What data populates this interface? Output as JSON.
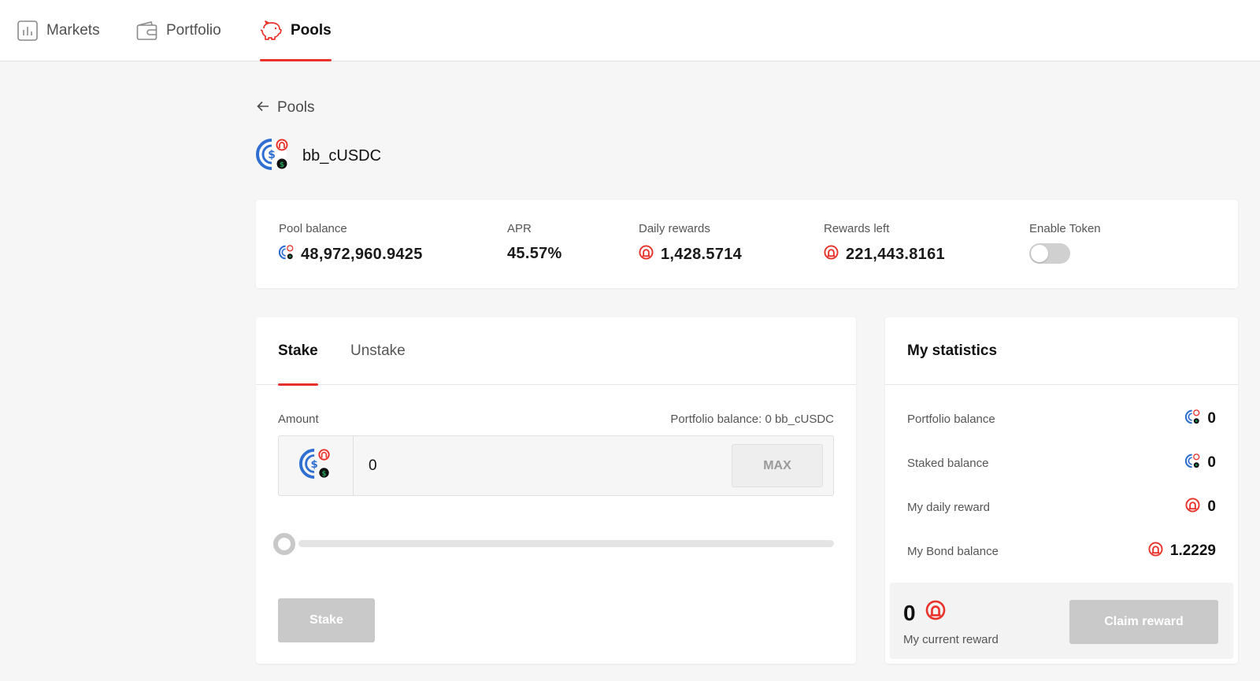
{
  "nav": {
    "items": [
      {
        "label": "Markets",
        "icon": "bar-chart-icon"
      },
      {
        "label": "Portfolio",
        "icon": "wallet-icon"
      },
      {
        "label": "Pools",
        "icon": "piggy-bank-icon",
        "active": true
      }
    ]
  },
  "breadcrumb": {
    "back_label": "Pools"
  },
  "pool": {
    "name": "bb_cUSDC",
    "token_icon": "bb-cusdc-token-icon"
  },
  "summary": {
    "pool_balance": {
      "label": "Pool balance",
      "value": "48,972,960.9425"
    },
    "apr": {
      "label": "APR",
      "value": "45.57%"
    },
    "daily_rewards": {
      "label": "Daily rewards",
      "value": "1,428.5714"
    },
    "rewards_left": {
      "label": "Rewards left",
      "value": "221,443.8161"
    },
    "enable_token": {
      "label": "Enable Token",
      "enabled": false
    }
  },
  "stake": {
    "tabs": [
      {
        "label": "Stake",
        "active": true
      },
      {
        "label": "Unstake",
        "active": false
      }
    ],
    "amount_label": "Amount",
    "portfolio_balance": "Portfolio balance: 0 bb_cUSDC",
    "amount_value": "0",
    "max_label": "MAX",
    "slider_percent": 0,
    "button_label": "Stake"
  },
  "statistics": {
    "title": "My statistics",
    "rows": [
      {
        "label": "Portfolio balance",
        "value": "0",
        "icon": "bb-cusdc-token-icon"
      },
      {
        "label": "Staked balance",
        "value": "0",
        "icon": "bb-cusdc-token-icon"
      },
      {
        "label": "My daily reward",
        "value": "0",
        "icon": "bond-token-icon"
      },
      {
        "label": "My Bond balance",
        "value": "1.2229",
        "icon": "bond-token-icon"
      }
    ],
    "current_reward": {
      "value": "0",
      "label": "My current reward"
    },
    "claim_label": "Claim reward"
  },
  "colors": {
    "accent": "#e8322b",
    "token_blue": "#2f6fd1",
    "token_green": "#1f9d55",
    "disabled_button": "#c9c9c9",
    "background": "#f6f6f6"
  }
}
